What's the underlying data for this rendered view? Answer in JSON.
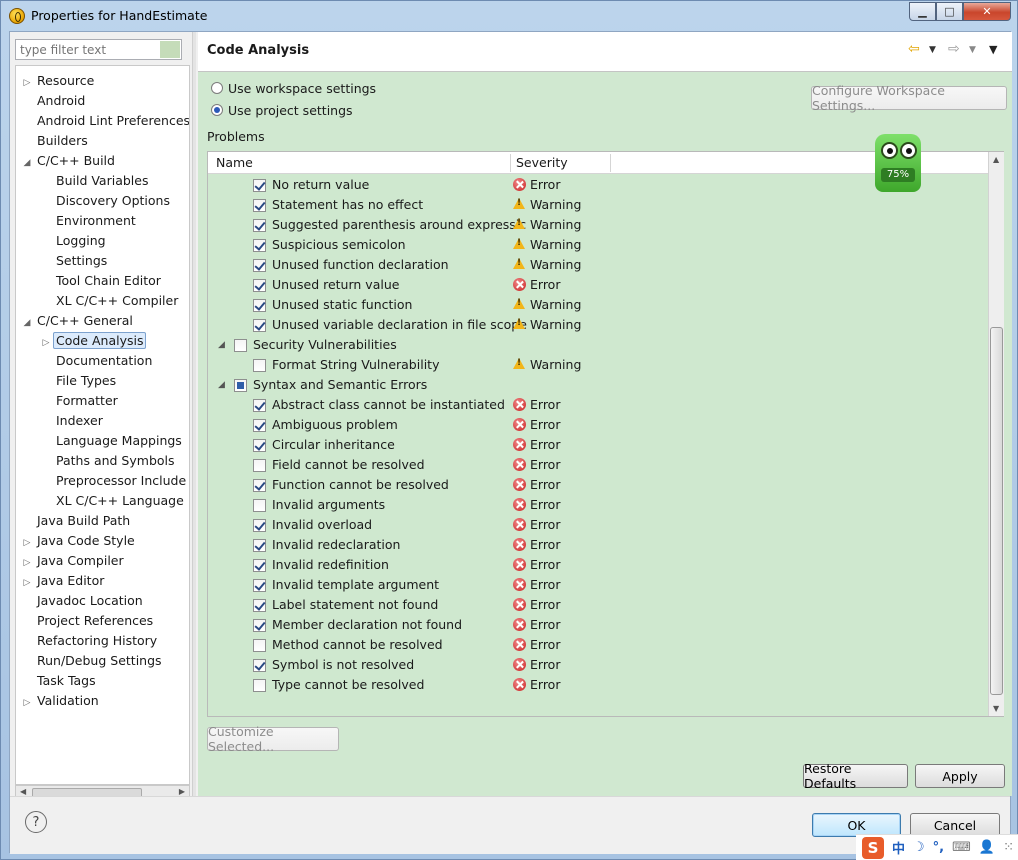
{
  "window": {
    "title": "Properties for HandEstimate",
    "minimize_label": "▁",
    "maximize_label": "□",
    "close_label": "✕"
  },
  "filter": {
    "placeholder": "type filter text",
    "value": ""
  },
  "tree": [
    {
      "label": "Resource",
      "depth": 0,
      "arrow": "right"
    },
    {
      "label": "Android",
      "depth": 0,
      "arrow": "none"
    },
    {
      "label": "Android Lint Preferences",
      "depth": 0,
      "arrow": "none"
    },
    {
      "label": "Builders",
      "depth": 0,
      "arrow": "none"
    },
    {
      "label": "C/C++ Build",
      "depth": 0,
      "arrow": "down"
    },
    {
      "label": "Build Variables",
      "depth": 1,
      "arrow": "none"
    },
    {
      "label": "Discovery Options",
      "depth": 1,
      "arrow": "none"
    },
    {
      "label": "Environment",
      "depth": 1,
      "arrow": "none"
    },
    {
      "label": "Logging",
      "depth": 1,
      "arrow": "none"
    },
    {
      "label": "Settings",
      "depth": 1,
      "arrow": "none"
    },
    {
      "label": "Tool Chain Editor",
      "depth": 1,
      "arrow": "none"
    },
    {
      "label": "XL C/C++ Compiler",
      "depth": 1,
      "arrow": "none"
    },
    {
      "label": "C/C++ General",
      "depth": 0,
      "arrow": "down"
    },
    {
      "label": "Code Analysis",
      "depth": 1,
      "arrow": "right",
      "selected": true
    },
    {
      "label": "Documentation",
      "depth": 1,
      "arrow": "none"
    },
    {
      "label": "File Types",
      "depth": 1,
      "arrow": "none"
    },
    {
      "label": "Formatter",
      "depth": 1,
      "arrow": "none"
    },
    {
      "label": "Indexer",
      "depth": 1,
      "arrow": "none"
    },
    {
      "label": "Language Mappings",
      "depth": 1,
      "arrow": "none"
    },
    {
      "label": "Paths and Symbols",
      "depth": 1,
      "arrow": "none"
    },
    {
      "label": "Preprocessor Include",
      "depth": 1,
      "arrow": "none"
    },
    {
      "label": "XL C/C++ Language",
      "depth": 1,
      "arrow": "none"
    },
    {
      "label": "Java Build Path",
      "depth": 0,
      "arrow": "none"
    },
    {
      "label": "Java Code Style",
      "depth": 0,
      "arrow": "right"
    },
    {
      "label": "Java Compiler",
      "depth": 0,
      "arrow": "right"
    },
    {
      "label": "Java Editor",
      "depth": 0,
      "arrow": "right"
    },
    {
      "label": "Javadoc Location",
      "depth": 0,
      "arrow": "none"
    },
    {
      "label": "Project References",
      "depth": 0,
      "arrow": "none"
    },
    {
      "label": "Refactoring History",
      "depth": 0,
      "arrow": "none"
    },
    {
      "label": "Run/Debug Settings",
      "depth": 0,
      "arrow": "none"
    },
    {
      "label": "Task Tags",
      "depth": 0,
      "arrow": "none"
    },
    {
      "label": "Validation",
      "depth": 0,
      "arrow": "right"
    }
  ],
  "page": {
    "title": "Code Analysis",
    "radio_workspace": "Use workspace settings",
    "radio_project": "Use project settings",
    "selected_radio": "project",
    "configure_button": "Configure Workspace Settings...",
    "problems_label": "Problems",
    "col_name": "Name",
    "col_severity": "Severity",
    "customize_button": "Customize Selected...",
    "restore_button": "Restore Defaults",
    "apply_button": "Apply",
    "mascot_percent": "75%"
  },
  "problems": [
    {
      "type": "item",
      "name": "No return value",
      "checked": true,
      "severity": "Error"
    },
    {
      "type": "item",
      "name": "Statement has no effect",
      "checked": true,
      "severity": "Warning"
    },
    {
      "type": "item",
      "name": "Suggested parenthesis around expressic",
      "checked": true,
      "severity": "Warning"
    },
    {
      "type": "item",
      "name": "Suspicious semicolon",
      "checked": true,
      "severity": "Warning"
    },
    {
      "type": "item",
      "name": "Unused function declaration",
      "checked": true,
      "severity": "Warning"
    },
    {
      "type": "item",
      "name": "Unused return value",
      "checked": true,
      "severity": "Error"
    },
    {
      "type": "item",
      "name": "Unused static function",
      "checked": true,
      "severity": "Warning"
    },
    {
      "type": "item",
      "name": "Unused variable declaration in file scope",
      "checked": true,
      "severity": "Warning"
    },
    {
      "type": "category",
      "name": "Security Vulnerabilities",
      "state": "unchecked"
    },
    {
      "type": "item",
      "name": "Format String Vulnerability",
      "checked": false,
      "severity": "Warning"
    },
    {
      "type": "category",
      "name": "Syntax and Semantic Errors",
      "state": "partial"
    },
    {
      "type": "item",
      "name": "Abstract class cannot be instantiated",
      "checked": true,
      "severity": "Error"
    },
    {
      "type": "item",
      "name": "Ambiguous problem",
      "checked": true,
      "severity": "Error"
    },
    {
      "type": "item",
      "name": "Circular inheritance",
      "checked": true,
      "severity": "Error"
    },
    {
      "type": "item",
      "name": "Field cannot be resolved",
      "checked": false,
      "severity": "Error"
    },
    {
      "type": "item",
      "name": "Function cannot be resolved",
      "checked": true,
      "severity": "Error"
    },
    {
      "type": "item",
      "name": "Invalid arguments",
      "checked": false,
      "severity": "Error"
    },
    {
      "type": "item",
      "name": "Invalid overload",
      "checked": true,
      "severity": "Error"
    },
    {
      "type": "item",
      "name": "Invalid redeclaration",
      "checked": true,
      "severity": "Error"
    },
    {
      "type": "item",
      "name": "Invalid redefinition",
      "checked": true,
      "severity": "Error"
    },
    {
      "type": "item",
      "name": "Invalid template argument",
      "checked": true,
      "severity": "Error"
    },
    {
      "type": "item",
      "name": "Label statement not found",
      "checked": true,
      "severity": "Error"
    },
    {
      "type": "item",
      "name": "Member declaration not found",
      "checked": true,
      "severity": "Error"
    },
    {
      "type": "item",
      "name": "Method cannot be resolved",
      "checked": false,
      "severity": "Error"
    },
    {
      "type": "item",
      "name": "Symbol is not resolved",
      "checked": true,
      "severity": "Error"
    },
    {
      "type": "item",
      "name": "Type cannot be resolved",
      "checked": false,
      "severity": "Error"
    }
  ],
  "footer": {
    "help_label": "?",
    "ok_button": "OK",
    "cancel_button": "Cancel"
  },
  "tray": {
    "logo": "S",
    "ime_label": "中",
    "moon": "☽",
    "punct": "°,",
    "keyboard": "⌨",
    "person": "👤",
    "grid": "⁙"
  },
  "colors": {
    "panel_bg": "#d0e8d0",
    "selection": "#dcebfc",
    "error": "#c91f1f",
    "warning": "#f2b619"
  }
}
